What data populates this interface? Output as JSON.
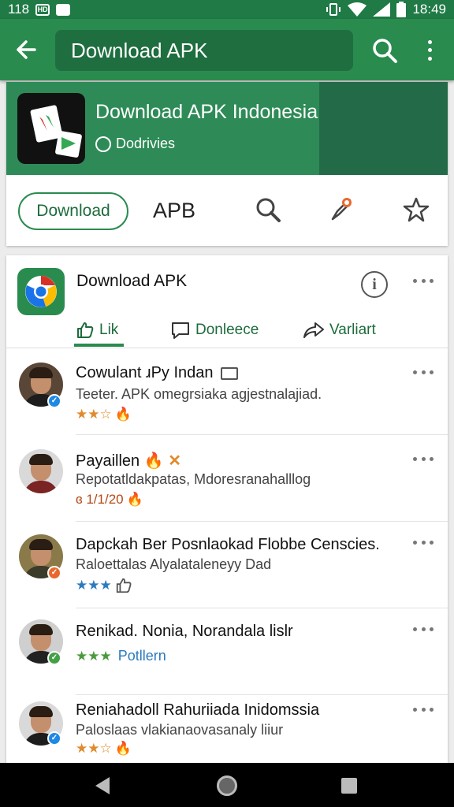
{
  "status_bar": {
    "left_text": "118",
    "left_icon_1": "hd-badge-icon",
    "left_icon_2": "notification-icon",
    "right_icons": [
      "vibrate-icon",
      "wifi-icon",
      "signal-icon",
      "battery-icon"
    ],
    "time": "18:49"
  },
  "app_bar": {
    "back_icon": "arrow-left-icon",
    "search_text": "Download APK",
    "search_icon": "search-icon",
    "more_icon": "more-vert-icon"
  },
  "app_card": {
    "title": "Download APK Indonesia",
    "subtitle": "Dodrivies",
    "actions": {
      "download_label": "Download",
      "apb_label": "APB",
      "icons": [
        "search-icon",
        "rocket-icon",
        "star-icon"
      ]
    }
  },
  "detail_card": {
    "title": "Download APK",
    "tabs": [
      {
        "label": "Lik",
        "icon": "thumbs-up-icon",
        "active": true
      },
      {
        "label": "Donleece",
        "icon": "comment-icon",
        "active": false
      },
      {
        "label": "Varliart",
        "icon": "share-icon",
        "active": false
      }
    ],
    "reviews": [
      {
        "name": "Cowulant ɹPy Indan",
        "subtitle": "Teeter. APK omegrsiaka agjestnalajiad.",
        "rating_text": "★★☆",
        "rating_extra": "",
        "badge_color": "#1e88e5"
      },
      {
        "name": "Payaillen",
        "subtitle": "Repotatldakpatas, Mdoresranahalllog",
        "rating_text": "",
        "rating_extra": "ɞ 1/1/20",
        "badge_color": "#ffffff"
      },
      {
        "name": "Dapckah Ber Posnlaokad Flobbe Censcies.",
        "subtitle": "Raloettalas Alyalataleneyy Dad",
        "rating_text": "★★★",
        "rating_extra": "",
        "badge_color": "#e8682e"
      },
      {
        "name": "Renikad. Nonia, Norandala lislr",
        "subtitle": "",
        "rating_text": "★★★",
        "rating_extra": "Potllern",
        "badge_color": "#43a047"
      },
      {
        "name": "Reniahadoll Rahuriiada Inidomssia",
        "subtitle": "Paloslaas vlakianaovasanaly liiur",
        "rating_text": "★★☆",
        "rating_extra": "",
        "badge_color": "#1e88e5"
      }
    ]
  },
  "colors": {
    "primary": "#2a8b4f",
    "primary_dark": "#1f6e40",
    "star_orange": "#e08a2c",
    "star_blue": "#2a7bbd",
    "star_green": "#4a9a3c"
  }
}
